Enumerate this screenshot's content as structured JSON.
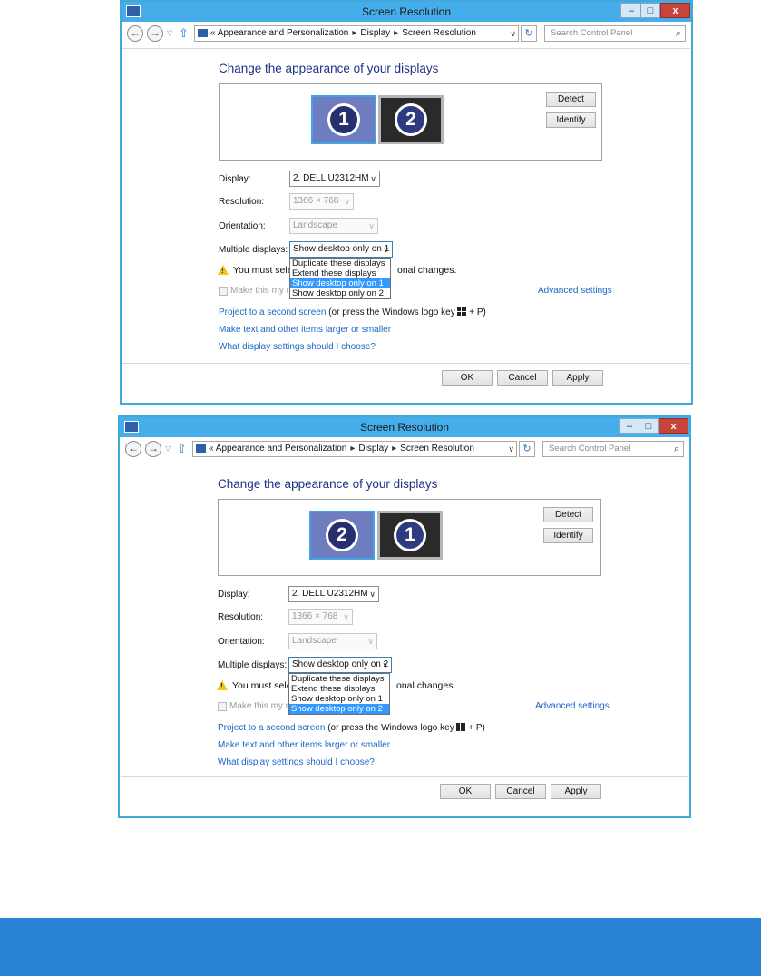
{
  "app_title": "Screen Resolution",
  "window_controls": {
    "min": "–",
    "max": "□",
    "close": "x"
  },
  "breadcrumb": {
    "root_prefix": "«",
    "items": [
      "Appearance and Personalization",
      "Display",
      "Screen Resolution"
    ],
    "separator": "▸"
  },
  "search": {
    "placeholder": "Search Control Panel"
  },
  "heading": "Change the appearance of your displays",
  "buttons": {
    "detect": "Detect",
    "identify": "Identify",
    "ok": "OK",
    "cancel": "Cancel",
    "apply": "Apply"
  },
  "labels": {
    "display": "Display:",
    "resolution": "Resolution:",
    "orientation": "Orientation:",
    "multiple": "Multiple displays:"
  },
  "display_value": "2. DELL U2312HM",
  "resolution_value": "1366 × 768",
  "orientation_value": "Landscape",
  "multiple_options": [
    "Duplicate these displays",
    "Extend these displays",
    "Show desktop only on 1",
    "Show desktop only on 2"
  ],
  "warning": {
    "left": "You must select",
    "right": "onal changes."
  },
  "main_display_checkbox": "Make this my ma",
  "advanced_settings": "Advanced settings",
  "links": {
    "project": "Project to a second screen",
    "project_hint_pre": "(or press the Windows logo key",
    "project_hint_post": "+ P)",
    "text_size": "Make text and other items larger or smaller",
    "which_settings": "What display settings should I choose?"
  },
  "window1": {
    "monitors": [
      "1",
      "2"
    ],
    "multiple_selected": "Show desktop only on 1",
    "highlighted_option_index": 2
  },
  "window2": {
    "monitors": [
      "2",
      "1"
    ],
    "multiple_selected": "Show desktop only on 2",
    "highlighted_option_index": 3
  },
  "colors": {
    "titlebar": "#45aeea",
    "window_border": "#42a8d9",
    "footer_bar": "#2a83d4",
    "link": "#1a66c6",
    "heading": "#1e3287",
    "selection": "#3399ff"
  }
}
